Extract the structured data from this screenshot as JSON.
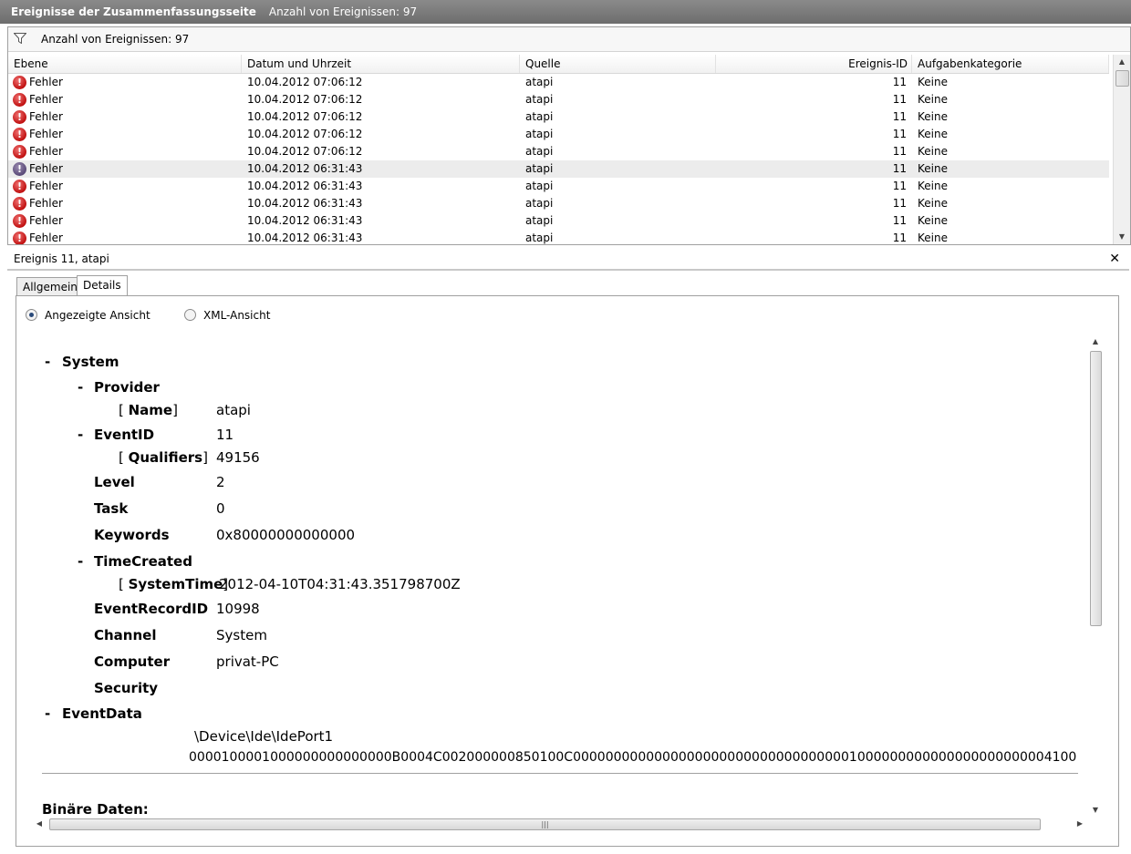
{
  "window": {
    "title": "Ereignisse der Zusammenfassungsseite",
    "count_label": "Anzahl von Ereignissen: 97"
  },
  "filter": {
    "label": "Anzahl von Ereignissen: 97",
    "icon": "funnel-icon"
  },
  "table": {
    "columns": [
      "Ebene",
      "Datum und Uhrzeit",
      "Quelle",
      "Ereignis-ID",
      "Aufgabenkategorie"
    ],
    "rows": [
      {
        "level": "Fehler",
        "datetime": "10.04.2012 07:06:12",
        "source": "atapi",
        "id": "11",
        "category": "Keine"
      },
      {
        "level": "Fehler",
        "datetime": "10.04.2012 07:06:12",
        "source": "atapi",
        "id": "11",
        "category": "Keine"
      },
      {
        "level": "Fehler",
        "datetime": "10.04.2012 07:06:12",
        "source": "atapi",
        "id": "11",
        "category": "Keine"
      },
      {
        "level": "Fehler",
        "datetime": "10.04.2012 07:06:12",
        "source": "atapi",
        "id": "11",
        "category": "Keine"
      },
      {
        "level": "Fehler",
        "datetime": "10.04.2012 07:06:12",
        "source": "atapi",
        "id": "11",
        "category": "Keine"
      },
      {
        "level": "Fehler",
        "datetime": "10.04.2012 06:31:43",
        "source": "atapi",
        "id": "11",
        "category": "Keine"
      },
      {
        "level": "Fehler",
        "datetime": "10.04.2012 06:31:43",
        "source": "atapi",
        "id": "11",
        "category": "Keine"
      },
      {
        "level": "Fehler",
        "datetime": "10.04.2012 06:31:43",
        "source": "atapi",
        "id": "11",
        "category": "Keine"
      },
      {
        "level": "Fehler",
        "datetime": "10.04.2012 06:31:43",
        "source": "atapi",
        "id": "11",
        "category": "Keine"
      },
      {
        "level": "Fehler",
        "datetime": "10.04.2012 06:31:43",
        "source": "atapi",
        "id": "11",
        "category": "Keine"
      }
    ],
    "selected_index": 5
  },
  "details": {
    "title": "Ereignis 11, atapi",
    "close_glyph": "✕",
    "tabs": [
      "Allgemein",
      "Details"
    ],
    "active_tab": "Details",
    "views": [
      "Angezeigte Ansicht",
      "XML-Ansicht"
    ],
    "selected_view": "Angezeigte Ansicht",
    "tree": {
      "system": "System",
      "provider": "Provider",
      "name_key": "Name",
      "name_val": "atapi",
      "eventid": "EventID",
      "eventid_val": "11",
      "qualifiers_key": "Qualifiers",
      "qualifiers_val": "49156",
      "level": "Level",
      "level_val": "2",
      "task": "Task",
      "task_val": "0",
      "keywords": "Keywords",
      "keywords_val": "0x80000000000000",
      "timecreated": "TimeCreated",
      "systemtime_key": "SystemTime",
      "systemtime_val": "2012-04-10T04:31:43.351798700Z",
      "recordid": "EventRecordID",
      "recordid_val": "10998",
      "channel": "Channel",
      "channel_val": "System",
      "computer": "Computer",
      "computer_val": "privat-PC",
      "security": "Security",
      "eventdata": "EventData",
      "eventdata_1": "\\Device\\Ide\\IdePort1",
      "eventdata_2": "0000100001000000000000000B0004C002000000850100C00000000000000000000000000000000001000000000000000000000004100",
      "binary": "Binäre Daten:"
    }
  }
}
